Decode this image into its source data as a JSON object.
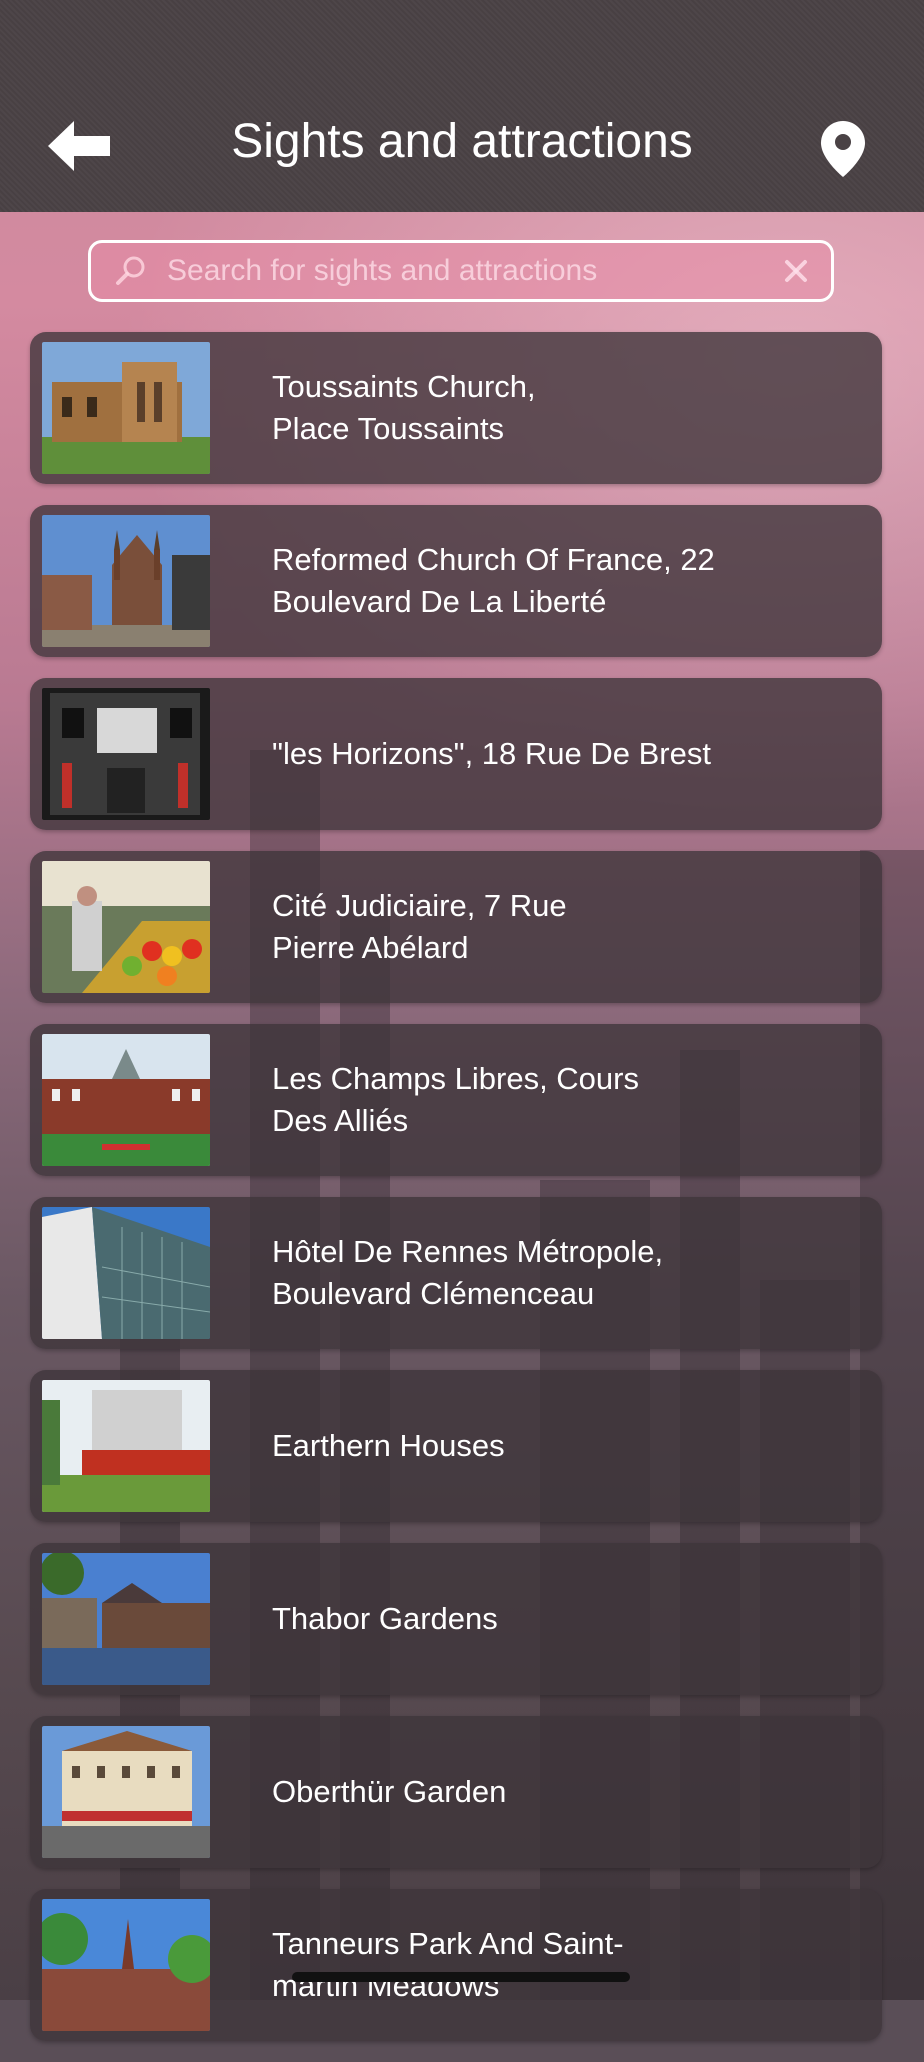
{
  "header": {
    "title": "Sights and attractions",
    "back_icon": "arrow-left-icon",
    "map_icon": "map-pin-icon"
  },
  "search": {
    "placeholder": "Search for sights and attractions",
    "value": ""
  },
  "items": [
    {
      "label": "Toussaints Church,\nPlace Toussaints"
    },
    {
      "label": "Reformed Church Of France, 22\nBoulevard De La Liberté"
    },
    {
      "label": "\"les Horizons\", 18 Rue De Brest"
    },
    {
      "label": "Cité Judiciaire, 7 Rue\nPierre Abélard"
    },
    {
      "label": "Les Champs Libres, Cours\nDes Alliés"
    },
    {
      "label": "Hôtel De Rennes Métropole,\nBoulevard Clémenceau"
    },
    {
      "label": "Earthern Houses"
    },
    {
      "label": "Thabor Gardens"
    },
    {
      "label": "Oberthür Garden"
    },
    {
      "label": "Tanneurs Park And Saint-\nmartin Meadows"
    }
  ],
  "colors": {
    "header_bg": "#4a4245",
    "card_bg": "#3e343a",
    "text": "#ffffff",
    "search_border": "#ffffff"
  }
}
